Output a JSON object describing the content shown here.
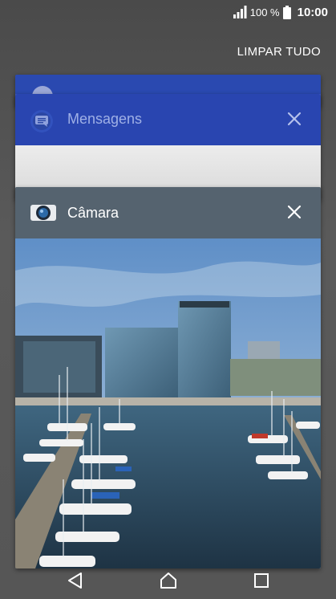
{
  "status_bar": {
    "battery_percent": "100 %",
    "time": "10:00",
    "icons": [
      "signal-icon",
      "battery-icon"
    ]
  },
  "recents": {
    "clear_all_label": "LIMPAR TUDO",
    "cards": [
      {
        "app": "Mensagens",
        "icon": "messages-icon",
        "header_color": "#2945b0"
      },
      {
        "app": "Câmara",
        "icon": "camera-icon",
        "header_color": "#55636f"
      }
    ]
  },
  "nav_bar": {
    "buttons": [
      "back-icon",
      "home-icon",
      "recents-icon"
    ]
  }
}
